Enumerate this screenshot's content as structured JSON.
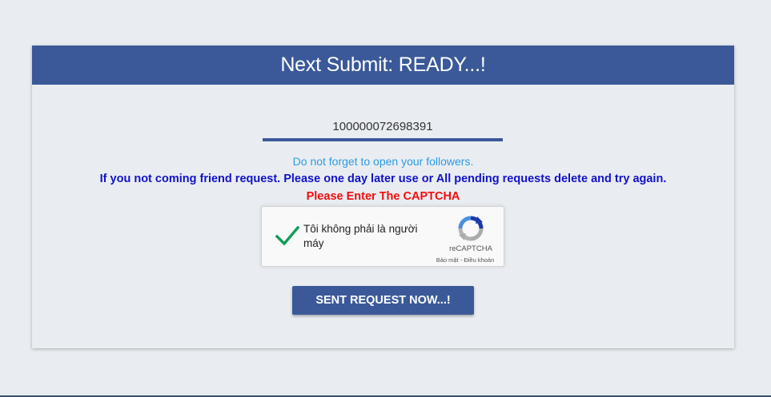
{
  "header": {
    "title": "Next Submit: READY...!",
    "color": "#3b5998"
  },
  "form": {
    "uid_value": "100000072698391"
  },
  "messages": {
    "followers": "Do not forget to open your followers.",
    "friend_request": "If you not coming friend request. Please one day later use or All pending requests delete and try again.",
    "captcha_prompt": "Please Enter The CAPTCHA"
  },
  "recaptcha": {
    "checkbox_icon": "checkmark-icon",
    "checked": true,
    "label": "Tôi không phải là người máy",
    "logo_icon": "recaptcha-logo-icon",
    "brand": "reCAPTCHA",
    "terms": "Bảo mật - Điều khoản"
  },
  "actions": {
    "submit_label": "SENT REQUEST NOW...!"
  },
  "colors": {
    "brand": "#3b5998",
    "background": "#e9edf1",
    "info": "#2d9be0",
    "notice": "#1212c8",
    "error": "#f20d0d",
    "check": "#0f9d58"
  }
}
